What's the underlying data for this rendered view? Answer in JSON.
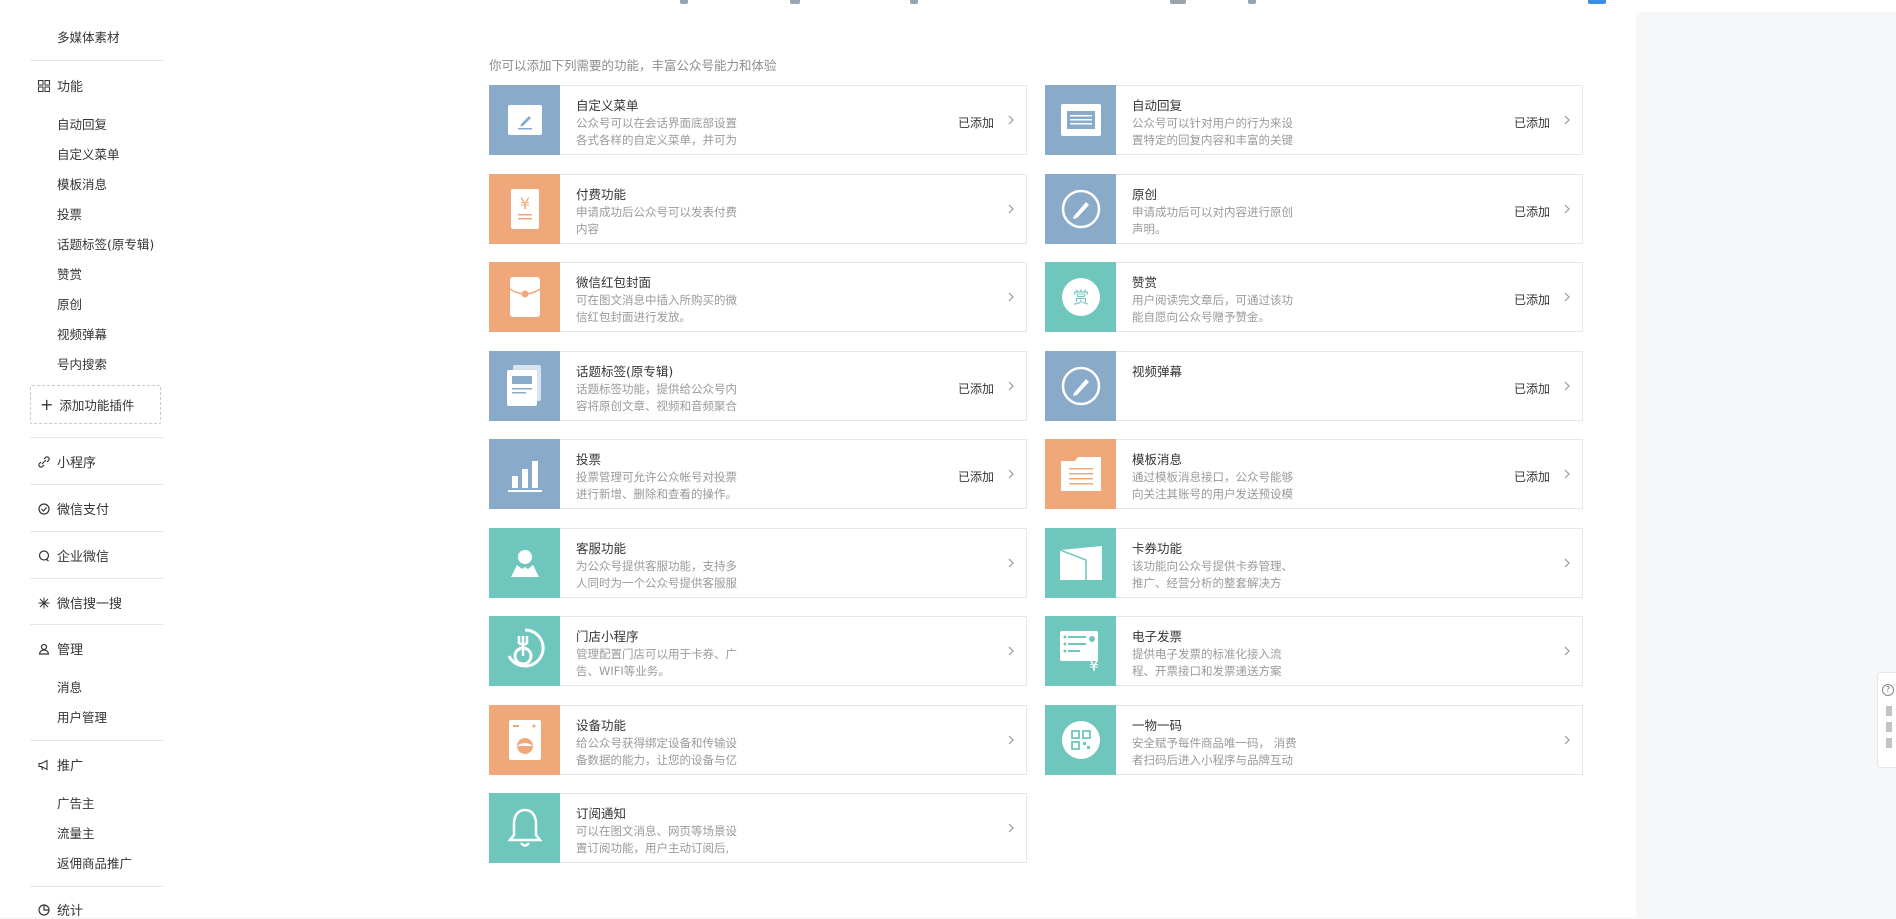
{
  "sidebar": {
    "top_item": "多媒体素材",
    "function": {
      "title": "功能",
      "items": [
        "自动回复",
        "自定义菜单",
        "模板消息",
        "投票",
        "话题标签(原专辑)",
        "赞赏",
        "原创",
        "视频弹幕",
        "号内搜索"
      ],
      "add_plugin": "添加功能插件"
    },
    "groups": [
      "小程序",
      "微信支付",
      "企业微信",
      "微信搜一搜"
    ],
    "manage": {
      "title": "管理",
      "items": [
        "消息",
        "用户管理"
      ]
    },
    "promote": {
      "title": "推广",
      "items": [
        "广告主",
        "流量主",
        "返佣商品推广"
      ]
    },
    "stats": "统计"
  },
  "main": {
    "intro": "你可以添加下列需要的功能，丰富公众号能力和体验",
    "cards": [
      {
        "title": "自定义菜单",
        "desc": "公众号可以在会话界面底部设置各式各样的自定义菜单，并可为",
        "status": "已添加",
        "icon": "edit-icon",
        "color": "blue"
      },
      {
        "title": "自动回复",
        "desc": "公众号可以针对用户的行为来设置特定的回复内容和丰富的关键",
        "status": "已添加",
        "icon": "message-icon",
        "color": "blue"
      },
      {
        "title": "付费功能",
        "desc": "申请成功后公众号可以发表付费内容",
        "status": "",
        "icon": "yuan-icon",
        "color": "orange"
      },
      {
        "title": "原创",
        "desc": "申请成功后可以对内容进行原创声明。",
        "status": "已添加",
        "icon": "pen-circle-icon",
        "color": "blue"
      },
      {
        "title": "微信红包封面",
        "desc": "可在图文消息中插入所购买的微信红包封面进行发放。",
        "status": "",
        "icon": "red-packet-icon",
        "color": "orange"
      },
      {
        "title": "赞赏",
        "desc": "用户阅读完文章后，可通过该功能自愿向公众号赠予赞金。",
        "status": "已添加",
        "icon": "reward-icon",
        "color": "teal",
        "icon_text": "赏"
      },
      {
        "title": "话题标签(原专辑)",
        "desc": "话题标签功能，提供给公众号内容将原创文章、视频和音频聚合",
        "status": "已添加",
        "icon": "album-icon",
        "color": "blue"
      },
      {
        "title": "视频弹幕",
        "desc": "",
        "status": "已添加",
        "icon": "pen-circle-icon",
        "color": "blue"
      },
      {
        "title": "投票",
        "desc": "投票管理可允许公众帐号对投票进行新增、删除和查看的操作。",
        "status": "已添加",
        "icon": "bar-chart-icon",
        "color": "blue"
      },
      {
        "title": "模板消息",
        "desc": "通过模板消息接口，公众号能够向关注其账号的用户发送预设模",
        "status": "已添加",
        "icon": "template-icon",
        "color": "orange"
      },
      {
        "title": "客服功能",
        "desc": "为公众号提供客服功能，支持多人同时为一个公众号提供客服服",
        "status": "",
        "icon": "customer-service-icon",
        "color": "teal"
      },
      {
        "title": "卡券功能",
        "desc": "该功能向公众号提供卡券管理、推广、经营分析的整套解决方",
        "status": "",
        "icon": "card-icon",
        "color": "teal"
      },
      {
        "title": "门店小程序",
        "desc": "管理配置门店可以用于卡券、广告、WIFI等业务。",
        "status": "",
        "icon": "store-icon",
        "color": "teal"
      },
      {
        "title": "电子发票",
        "desc": "提供电子发票的标准化接入流程、开票接口和发票递送方案",
        "status": "",
        "icon": "invoice-icon",
        "color": "teal"
      },
      {
        "title": "设备功能",
        "desc": "给公众号获得绑定设备和传输设备数据的能力，让您的设备与亿",
        "status": "",
        "icon": "device-icon",
        "color": "orange"
      },
      {
        "title": "一物一码",
        "desc": "安全赋予每件商品唯一码， 消费者扫码后进入小程序与品牌互动",
        "status": "",
        "icon": "qrcode-icon",
        "color": "teal"
      },
      {
        "title": "订阅通知",
        "desc": "可以在图文消息、网页等场景设置订阅功能，用户主动订阅后,",
        "status": "",
        "icon": "bell-icon",
        "color": "teal"
      }
    ]
  }
}
